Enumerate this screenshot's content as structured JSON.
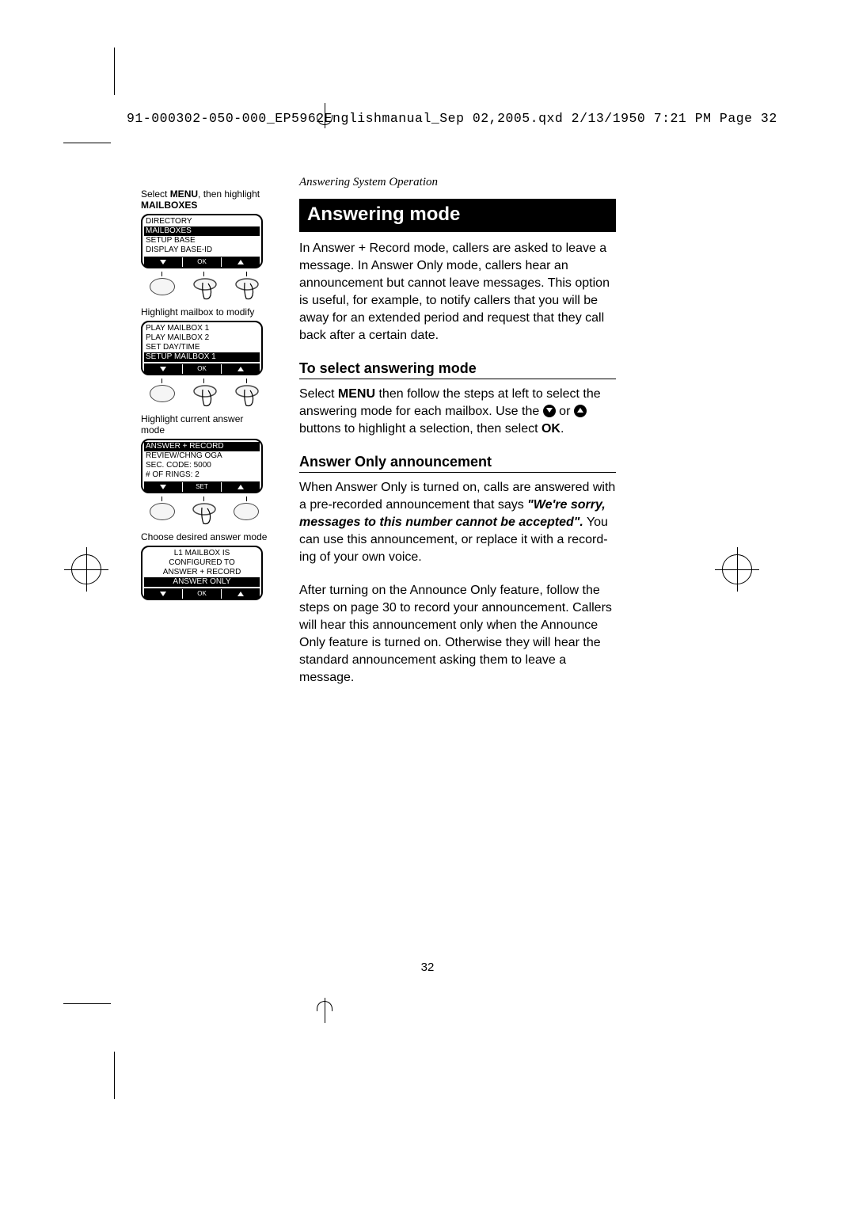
{
  "header_line": "91-000302-050-000_EP5962Englishmanual_Sep 02,2005.qxd  2/13/1950  7:21 PM  Page 32",
  "section_label": "Answering System Operation",
  "title": "Answering mode",
  "intro": "In Answer + Record mode, callers are asked to leave a message. In Answer Only mode, callers hear an announcement but cannot leave messages. This option is useful, for example, to notify callers that you will be away for an extended period and request that they call back after a certain date.",
  "sub1": "To select answering mode",
  "p1a": "Select ",
  "p1_menu": "MENU",
  "p1b": " then follow the steps at left to select the answering mode for each mailbox. Use the ",
  "p1c": " or ",
  "p1d": " buttons to highlight a selection, then select ",
  "p1_ok": "OK",
  "p1e": ".",
  "sub2": "Answer Only announcement",
  "p2a": "When Answer Only is turned on, calls are answered with a pre-recorded announcement that says ",
  "p2_quote": "\"We're sorry, messages to this number cannot be accepted\".",
  "p2b": " You can use this announcement, or replace it with a record­ing of your own voice.",
  "p3": "After turning on the Announce Only feature, follow the steps on page 30 to record your announcement. Callers will hear this announcement only when the Announce Only feature is turned on. Otherwise they will hear the standard announcement asking them to leave a message.",
  "page_num": "32",
  "left": {
    "cap1a": "Select ",
    "cap1_menu": "MENU",
    "cap1b": ", then highlight ",
    "cap1_mail": "MAILBOXES",
    "s1": {
      "r1": "DIRECTORY",
      "r2": "MAILBOXES",
      "r3": "SETUP BASE",
      "r4": "DISPLAY BASE-ID",
      "sk": "OK"
    },
    "cap2": "Highlight mailbox to modify",
    "s2": {
      "r1": "PLAY MAILBOX 1",
      "r2": "PLAY MAILBOX 2",
      "r3": "SET DAY/TIME",
      "r4": "SETUP MAILBOX 1",
      "sk": "OK"
    },
    "cap3": "Highlight current answer mode",
    "s3": {
      "r1": "ANSWER + RECORD",
      "r2": "REVIEW/CHNG OGA",
      "r3": "SEC. CODE: 5000",
      "r4": "# OF RINGS: 2",
      "sk": "SET"
    },
    "cap4": "Choose desired answer mode",
    "s4": {
      "r1": "L1 MAILBOX IS",
      "r2": "CONFIGURED TO",
      "r3": "ANSWER + RECORD",
      "r4": "ANSWER ONLY",
      "sk": "OK"
    }
  }
}
